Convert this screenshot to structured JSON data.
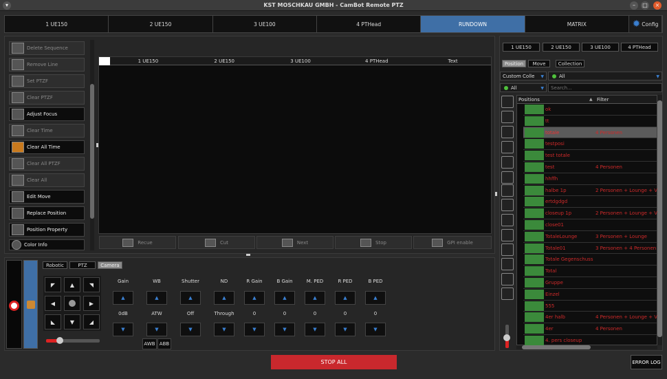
{
  "window": {
    "title": "KST MOSCHKAU GMBH - CamBot Remote PTZ"
  },
  "top_tabs": [
    {
      "label": "1 UE150"
    },
    {
      "label": "2 UE150"
    },
    {
      "label": "3 UE100"
    },
    {
      "label": "4 PTHead"
    },
    {
      "label": "RUNDOWN"
    },
    {
      "label": "MATRIX"
    }
  ],
  "config_label": "Config",
  "sidebar": {
    "items": [
      {
        "label": "Delete Sequence",
        "state": "dim"
      },
      {
        "label": "Remove Line",
        "state": "dim"
      },
      {
        "label": "Set PTZF",
        "state": "dim"
      },
      {
        "label": "Clear PTZF",
        "state": "dim"
      },
      {
        "label": "Adjust Focus",
        "state": "on"
      },
      {
        "label": "Clear Time",
        "state": "dim"
      },
      {
        "label": "Clear All Time",
        "state": "on"
      },
      {
        "label": "Clear All PTZF",
        "state": "dim"
      },
      {
        "label": "Clear All",
        "state": "dim"
      },
      {
        "label": "Edit Move",
        "state": "on"
      },
      {
        "label": "Replace Position",
        "state": "on"
      },
      {
        "label": "Position Property",
        "state": "on"
      },
      {
        "label": "Color Info",
        "state": "on"
      }
    ]
  },
  "rundown": {
    "columns": [
      "1 UE150",
      "2 UE150",
      "3 UE100",
      "4 PTHead",
      "Text"
    ]
  },
  "actions": [
    {
      "label": "Recue"
    },
    {
      "label": "Cut"
    },
    {
      "label": "Next"
    },
    {
      "label": "Stop"
    },
    {
      "label": "GPI enable"
    }
  ],
  "camera_tabs": [
    "Robotic",
    "PTZ",
    "Camera"
  ],
  "camera_controls": [
    {
      "label": "Gain",
      "value": "0dB"
    },
    {
      "label": "WB",
      "value": "ATW"
    },
    {
      "label": "Shutter",
      "value": "Off"
    },
    {
      "label": "ND",
      "value": "Through"
    },
    {
      "label": "R Gain",
      "value": "0"
    },
    {
      "label": "B Gain",
      "value": "0"
    },
    {
      "label": "M. PED",
      "value": "0"
    },
    {
      "label": "R PED",
      "value": "0"
    },
    {
      "label": "B PED",
      "value": "0"
    }
  ],
  "wb_buttons": {
    "awb": "AWB",
    "abb": "ABB"
  },
  "pan_speed_percent": 25,
  "right_tabs": [
    "1 UE150",
    "2 UE150",
    "3 UE100",
    "4 PTHead"
  ],
  "list_tabs": [
    "Position",
    "Move",
    "Collection"
  ],
  "collection_combo": "Custom Colle",
  "filter_combo": "All",
  "filter2_combo": "All",
  "search": {
    "placeholder": "Search..."
  },
  "positions": {
    "header_name": "Positions",
    "header_filter": "Filter",
    "rows": [
      {
        "name": "ok",
        "filter": ""
      },
      {
        "name": "tt",
        "filter": ""
      },
      {
        "name": "totale",
        "filter": "4 Personen",
        "selected": true
      },
      {
        "name": "testposi",
        "filter": ""
      },
      {
        "name": "test totale",
        "filter": ""
      },
      {
        "name": "test",
        "filter": "4 Personen"
      },
      {
        "name": "hhffh",
        "filter": ""
      },
      {
        "name": "halbe 1p",
        "filter": "2 Personen + Lounge + Vi"
      },
      {
        "name": "ertdgdgd",
        "filter": ""
      },
      {
        "name": "closeup 1p",
        "filter": "2 Personen + Lounge + Vi"
      },
      {
        "name": "close01",
        "filter": ""
      },
      {
        "name": "TotaleLounge",
        "filter": "3 Personen + Lounge"
      },
      {
        "name": "Totale01",
        "filter": "3 Personen + 4 Personen"
      },
      {
        "name": "Totale Gegenschuss",
        "filter": ""
      },
      {
        "name": "Total",
        "filter": ""
      },
      {
        "name": "Gruppe",
        "filter": ""
      },
      {
        "name": "Einzel",
        "filter": ""
      },
      {
        "name": "555",
        "filter": ""
      },
      {
        "name": "4er halb",
        "filter": "4 Personen + Lounge + Vi"
      },
      {
        "name": "4er",
        "filter": "4 Personen"
      },
      {
        "name": "4. pers closeup",
        "filter": ""
      }
    ]
  },
  "bottom": {
    "stop_all": "STOP ALL",
    "error_log": "ERROR LOG"
  },
  "colors": {
    "accent": "#3f6fa6",
    "stop": "#c9282d",
    "text_red": "#cf2a2a"
  }
}
